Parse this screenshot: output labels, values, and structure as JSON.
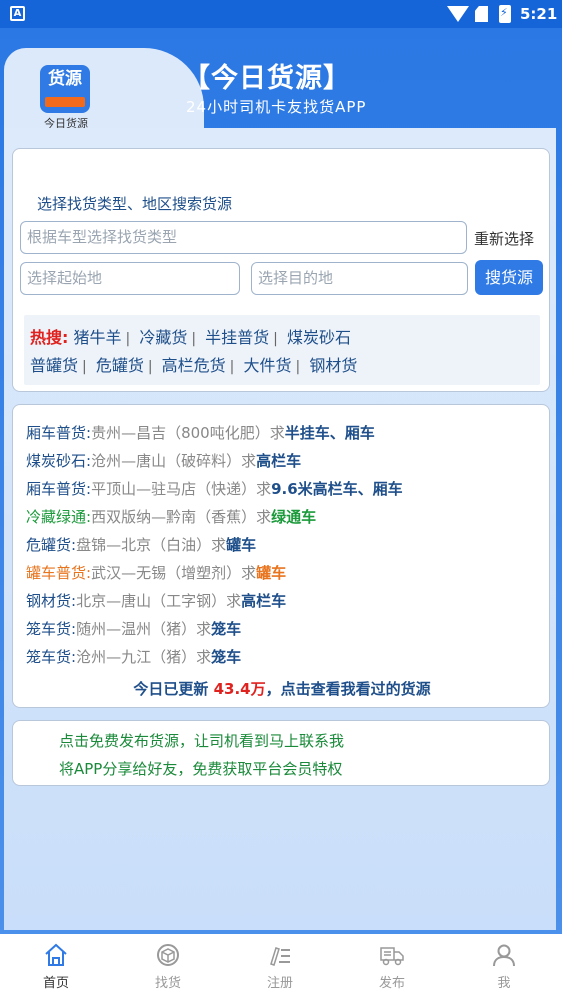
{
  "status_bar": {
    "time": "5:21",
    "left_icon": "A"
  },
  "header": {
    "logo_text": "货源",
    "logo_caption": "今日货源",
    "title": "【今日货源】",
    "subtitle": "24小时司机卡友找货APP"
  },
  "search": {
    "hint": "选择找货类型、地区搜索货源",
    "vehicle_placeholder": "根据车型选择找货类型",
    "origin_placeholder": "选择起始地",
    "dest_placeholder": "选择目的地",
    "reset_label": "重新选择",
    "search_label": "搜货源",
    "hot_label": "热搜:",
    "hot_row1": [
      "猪牛羊",
      "冷藏货",
      "半挂普货",
      "煤炭砂石"
    ],
    "hot_row2": [
      "普罐货",
      "危罐货",
      "高栏危货",
      "大件货",
      "钢材货"
    ]
  },
  "cargo_list": [
    {
      "category": "厢车普货:",
      "route": "贵州—昌吉（800吨化肥）",
      "req": "求",
      "vehicle": "半挂车、厢车",
      "color": "blue"
    },
    {
      "category": "煤炭砂石:",
      "route": "沧州—唐山（破碎料）",
      "req": "求",
      "vehicle": "高栏车",
      "color": "blue"
    },
    {
      "category": "厢车普货:",
      "route": "平顶山—驻马店（快递）",
      "req": "求",
      "vehicle": "9.6米高栏车、厢车",
      "color": "blue"
    },
    {
      "category": "冷藏绿通:",
      "route": "西双版纳—黔南（香蕉）",
      "req": "求",
      "vehicle": "绿通车",
      "color": "green"
    },
    {
      "category": "危罐货:",
      "route": "盘锦—北京（白油）",
      "req": "求",
      "vehicle": "罐车",
      "color": "blue"
    },
    {
      "category": "罐车普货:",
      "route": "武汉—无锡（增塑剂）",
      "req": "求",
      "vehicle": "罐车",
      "color": "orange"
    },
    {
      "category": "钢材货:",
      "route": "北京—唐山（工字钢）",
      "req": "求",
      "vehicle": "高栏车",
      "color": "blue"
    },
    {
      "category": "笼车货:",
      "route": "随州—温州（猪）",
      "req": "求",
      "vehicle": "笼车",
      "color": "blue"
    },
    {
      "category": "笼车货:",
      "route": "沧州—九江（猪）",
      "req": "求",
      "vehicle": "笼车",
      "color": "blue"
    }
  ],
  "update": {
    "prefix": "今日已更新 ",
    "count": "43.4万",
    "suffix": "，点击查看我看过的货源"
  },
  "promo": {
    "line1": "点击免费发布货源，让司机看到马上联系我",
    "line2": "将APP分享给好友，免费获取平台会员特权"
  },
  "nav": [
    {
      "label": "首页",
      "icon": "home-icon",
      "active": true
    },
    {
      "label": "找货",
      "icon": "box-icon",
      "active": false
    },
    {
      "label": "注册",
      "icon": "register-icon",
      "active": false
    },
    {
      "label": "发布",
      "icon": "truck-icon",
      "active": false
    },
    {
      "label": "我",
      "icon": "user-icon",
      "active": false
    }
  ],
  "colors": {
    "primary": "#2f7ae5",
    "hot_red": "#e0221f",
    "green": "#1a9a3a",
    "orange": "#e8741e",
    "text_blue": "#1f4f8a"
  }
}
